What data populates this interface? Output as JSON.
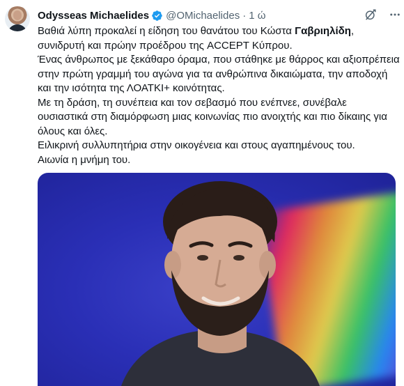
{
  "tweet": {
    "display_name": "Odysseas Michaelides",
    "handle": "@OMichaelides",
    "separator": "·",
    "time": "1 ώ",
    "body": {
      "line1_pre": "Βαθιά λύπη προκαλεί η είδηση του θανάτου του Κώστα ",
      "line1_bold": "Γαβριηλίδη",
      "line1_post": ",",
      "line2": "συνιδρυτή και πρώην προέδρου της ACCEPT Κύπρου.",
      "para2": "Ένας άνθρωπος με ξεκάθαρο όραμα, που στάθηκε με θάρρος και αξιοπρέπεια στην πρώτη γραμμή του αγώνα για τα ανθρώπινα δικαιώματα, την αποδοχή και την ισότητα της ΛΟΑΤΚΙ+ κοινότητας.",
      "para3": "Με τη δράση, τη συνέπεια και τον σεβασμό που ενέπνεε, συνέβαλε ουσιαστικά στη διαμόρφωση μιας κοινωνίας πιο ανοιχτής και πιο δίκαιης για όλους και όλες.",
      "para4": "Ειλικρινή συλλυπητήρια στην οικογένεια και στους αγαπημένους του.",
      "para5": "Αιωνία η μνήμη του."
    },
    "icons": {
      "verified": "verified-badge-icon",
      "grok": "grok-icon",
      "more": "more-icon"
    },
    "colors": {
      "verified": "#1d9bf0",
      "media_bg": "#2a2fb6"
    }
  }
}
